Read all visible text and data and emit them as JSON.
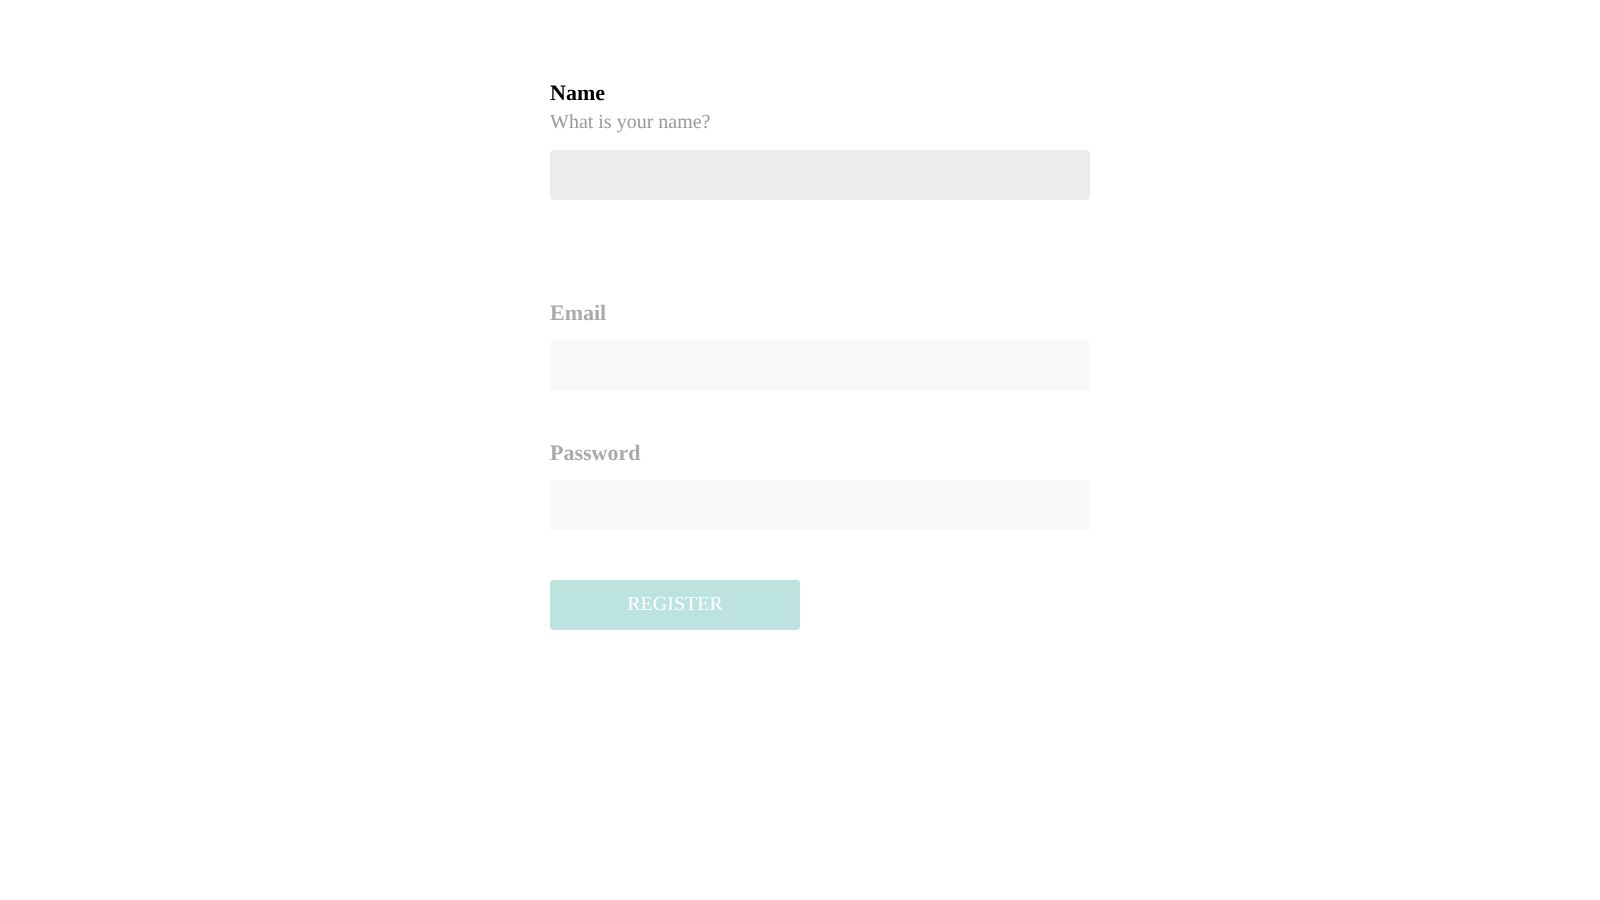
{
  "fields": [
    {
      "label": "Name",
      "hint": "What is your name?",
      "active": true
    },
    {
      "label": "Email",
      "active": false
    },
    {
      "label": "Password",
      "active": false
    }
  ],
  "button": {
    "label": "REGISTER",
    "disabled": true
  }
}
